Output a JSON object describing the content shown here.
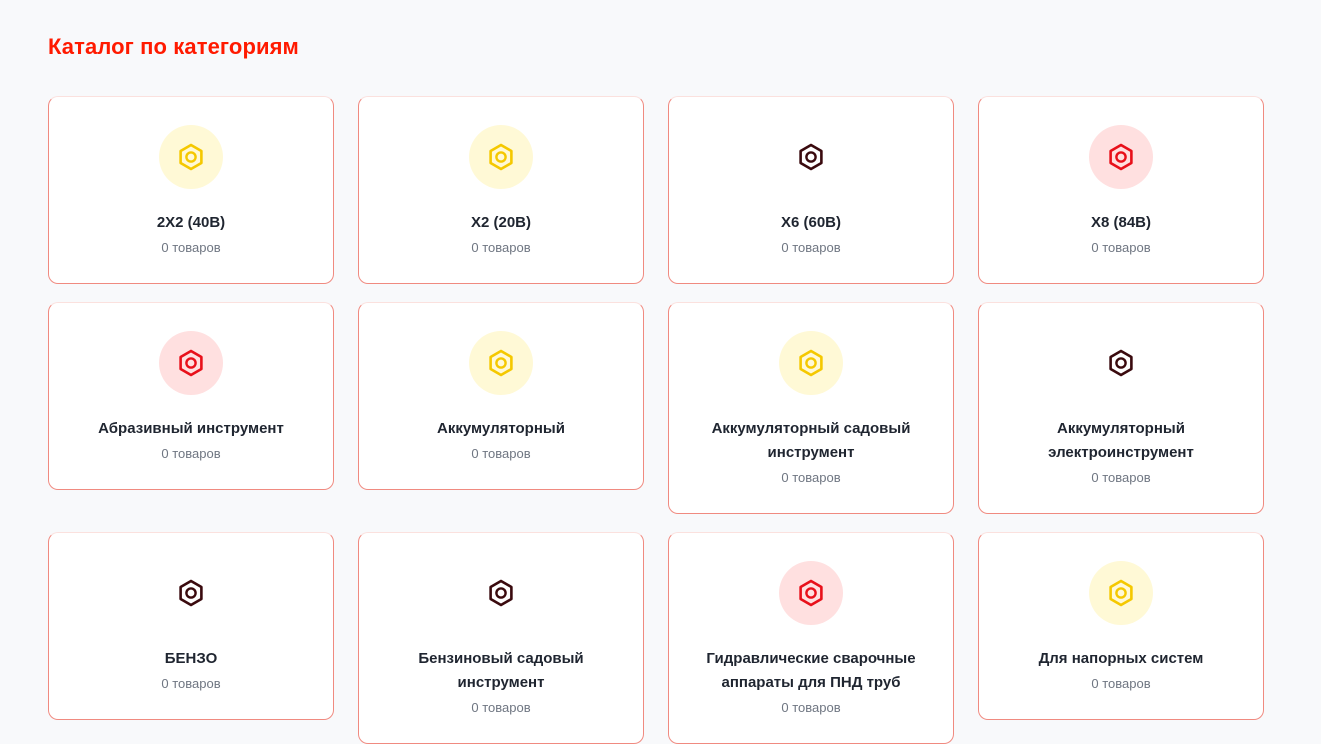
{
  "title": "Каталог по категориям",
  "count_label": "0 товаров",
  "colors": {
    "title": "#ff1a00",
    "yellow_bg": "#fff9d6",
    "yellow_icon": "#f5c800",
    "red_bg": "#ffe0e0",
    "red_icon": "#e8101a",
    "dark_icon": "#3a0a0e",
    "card_border": "#f08a80"
  },
  "categories": [
    {
      "name": "2Х2 (40В)",
      "count": "0 товаров",
      "icon": "hex-nut-icon",
      "style": "yellow"
    },
    {
      "name": "Х2 (20В)",
      "count": "0 товаров",
      "icon": "hex-nut-icon",
      "style": "yellow"
    },
    {
      "name": "Х6 (60В)",
      "count": "0 товаров",
      "icon": "hex-nut-icon",
      "style": "dark"
    },
    {
      "name": "Х8 (84В)",
      "count": "0 товаров",
      "icon": "hex-nut-icon",
      "style": "red"
    },
    {
      "name": "Абразивный инструмент",
      "count": "0 товаров",
      "icon": "hex-nut-icon",
      "style": "red"
    },
    {
      "name": "Аккумуляторный",
      "count": "0 товаров",
      "icon": "hex-nut-icon",
      "style": "yellow"
    },
    {
      "name": "Аккумуляторный садовый инструмент",
      "count": "0 товаров",
      "icon": "hex-nut-icon",
      "style": "yellow"
    },
    {
      "name": "Аккумуляторный электроинструмент",
      "count": "0 товаров",
      "icon": "hex-nut-icon",
      "style": "dark"
    },
    {
      "name": "БЕНЗО",
      "count": "0 товаров",
      "icon": "hex-nut-icon",
      "style": "dark"
    },
    {
      "name": "Бензиновый садовый инструмент",
      "count": "0 товаров",
      "icon": "hex-nut-icon",
      "style": "dark"
    },
    {
      "name": "Гидравлические сварочные аппараты для ПНД труб",
      "count": "0 товаров",
      "icon": "hex-nut-icon",
      "style": "red"
    },
    {
      "name": "Для напорных систем",
      "count": "0 товаров",
      "icon": "hex-nut-icon",
      "style": "yellow"
    }
  ]
}
